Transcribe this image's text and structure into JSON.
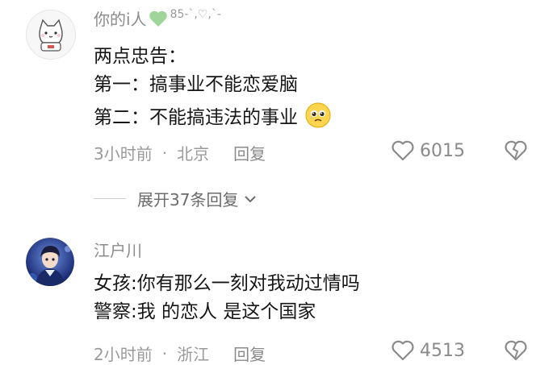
{
  "comments": [
    {
      "username": "你的i人",
      "username_badge": "85-`,♡,`-",
      "lines": [
        "两点忠告：",
        "第一：搞事业不能恋爱脑",
        "第二：不能搞违法的事业"
      ],
      "time": "3小时前",
      "separator": "·",
      "location": "北京",
      "reply_label": "回复",
      "likes": "6015",
      "avatar_icon": "cat-icon",
      "colors": {
        "heart_badge": "#9ed69a"
      }
    },
    {
      "username": "江户川",
      "lines": [
        "女孩:你有那么一刻对我动过情吗",
        "警察:我 的恋人 是这个国家"
      ],
      "time": "2小时前",
      "separator": "·",
      "location": "浙江",
      "reply_label": "回复",
      "likes": "4513",
      "avatar_icon": "anime-character-avatar"
    }
  ],
  "expand_replies": "展开37条回复",
  "icons": {
    "like": "heart-outline-icon",
    "dislike": "broken-heart-icon",
    "expand": "chevron-down-icon",
    "emoji": "pleading-face-emoji"
  },
  "colors": {
    "text": "#161616",
    "muted": "#8c8c8c",
    "divider": "#cfcfcf"
  }
}
